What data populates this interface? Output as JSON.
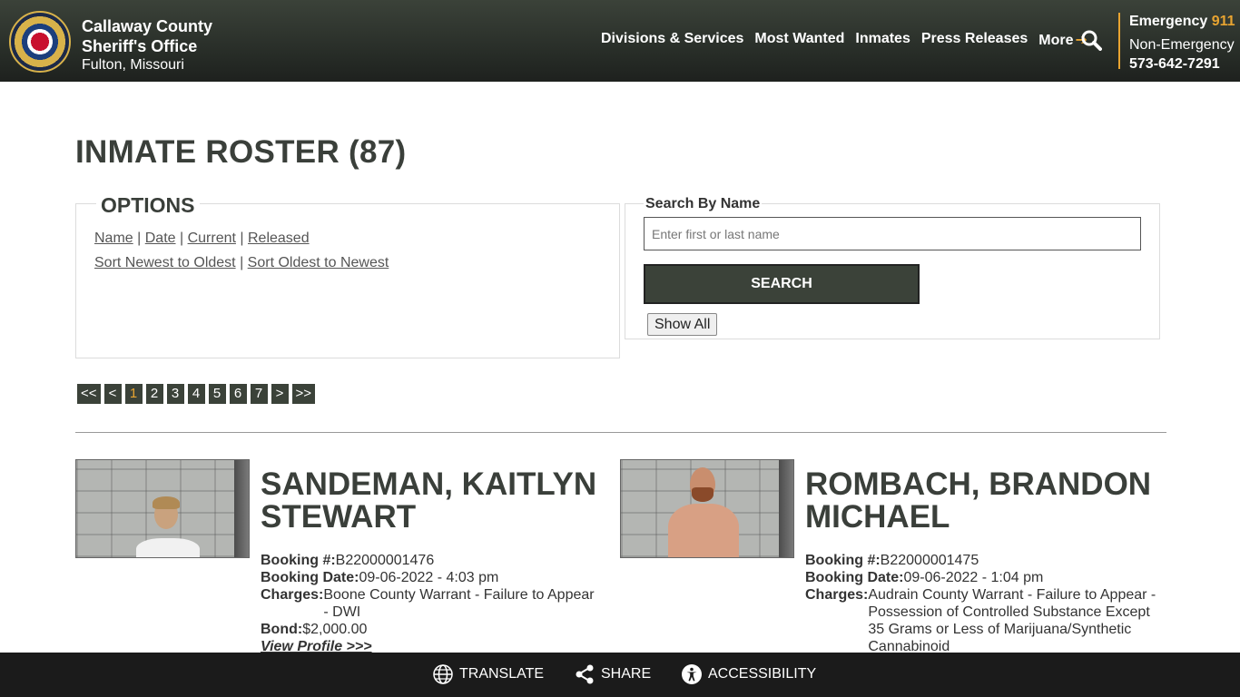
{
  "header": {
    "org_line1": "Callaway County",
    "org_line2": "Sheriff's Office",
    "location": "Fulton, Missouri",
    "nav": [
      {
        "label": "Divisions & Services"
      },
      {
        "label": "Most Wanted"
      },
      {
        "label": "Inmates"
      },
      {
        "label": "Press Releases"
      },
      {
        "label": "More"
      }
    ],
    "emergency_label": "Emergency",
    "emergency_number": "911",
    "non_emergency_label": "Non-Emergency",
    "non_emergency_number": "573-642-7291",
    "accent_color": "#e8a431"
  },
  "main": {
    "title": "INMATE ROSTER (87)",
    "options": {
      "legend": "OPTIONS",
      "filters": [
        "Name",
        "Date",
        "Current",
        "Released"
      ],
      "sorts": [
        "Sort Newest to Oldest",
        "Sort Oldest to Newest"
      ]
    },
    "search": {
      "label": "Search By Name",
      "placeholder": "Enter first or last name",
      "button": "SEARCH",
      "show_all": "Show All"
    },
    "pager": {
      "items": [
        "<<",
        "<",
        "1",
        "2",
        "3",
        "4",
        "5",
        "6",
        "7",
        ">",
        ">>"
      ],
      "current": "1"
    },
    "labels": {
      "booking_no": "Booking #:",
      "booking_date": "Booking Date:",
      "charges": "Charges:",
      "bond": "Bond:",
      "view_profile": "View Profile >>>"
    },
    "inmates": [
      {
        "name": "SANDEMAN, KAITLYN STEWART",
        "booking_no": "B22000001476",
        "booking_date": "09-06-2022 - 4:03 pm",
        "charges": "Boone County Warrant - Failure to Appear - DWI",
        "bond": "$2,000.00"
      },
      {
        "name": "ROMBACH, BRANDON MICHAEL",
        "booking_no": "B22000001475",
        "booking_date": "09-06-2022 - 1:04 pm",
        "charges": "Audrain County Warrant - Failure to Appear - Possession of Controlled Substance Except 35 Grams or Less of Marijuana/Synthetic Cannabinoid"
      }
    ]
  },
  "footer": {
    "translate": "TRANSLATE",
    "share": "SHARE",
    "accessibility": "ACCESSIBILITY"
  }
}
